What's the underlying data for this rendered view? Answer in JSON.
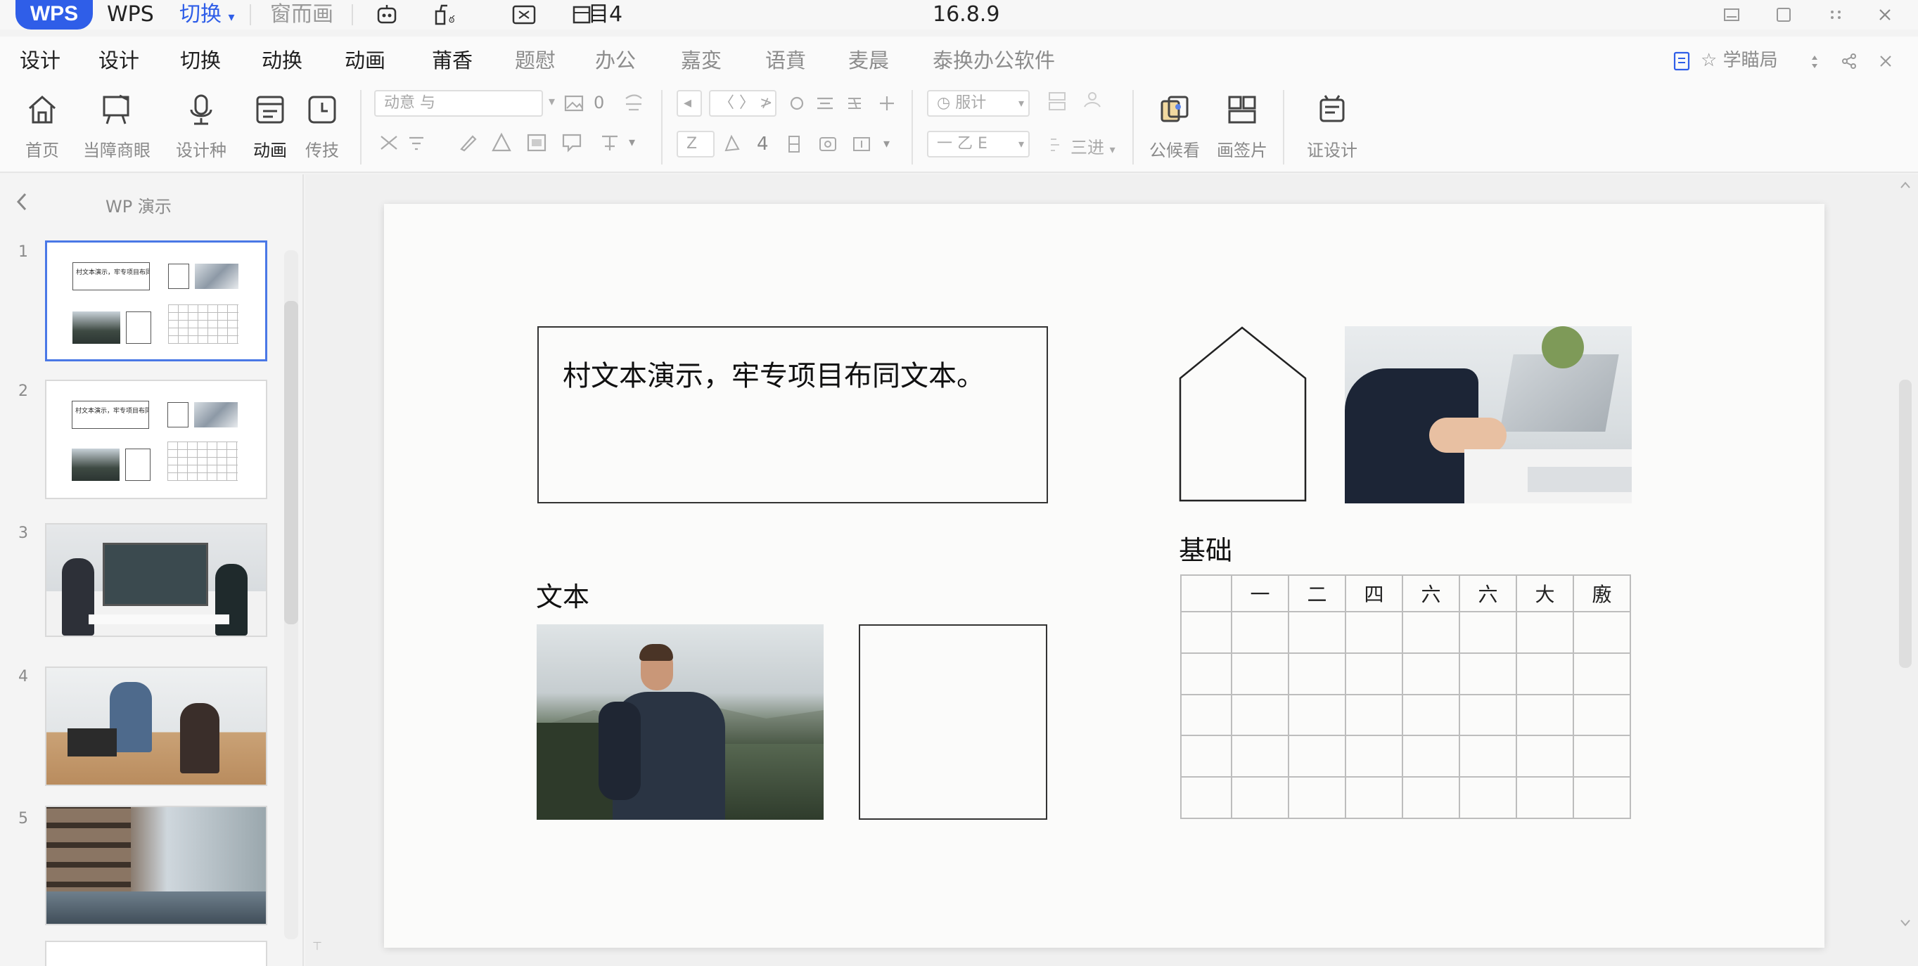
{
  "titlebar": {
    "logo": "WPS",
    "app_name": "WPS",
    "switch_menu": "切换",
    "doc_tab": "窗而画",
    "counter": "目4",
    "version": "16.8.9"
  },
  "menu": {
    "items": [
      "设计",
      "设计",
      "切换",
      "动换",
      "动画",
      "莆香",
      "题慰",
      "办公",
      "嘉変",
      "语賁",
      "麦晨",
      "泰换办公软件"
    ],
    "right_label": "☆ 学瞄局"
  },
  "ribbon": {
    "home": "首页",
    "screen_edit": "当障商眼",
    "design_kit": "设计种",
    "animation": "动画",
    "transfer": "传技",
    "font_name_placeholder": "动意 与",
    "font_size": "0",
    "style_select": "◷ 服计",
    "layout_select": "一 乙 E",
    "three_way": "三进",
    "size_value": "Z",
    "number_value": "4",
    "public_library": "公候看",
    "gallery": "画签片",
    "redesign": "证设计"
  },
  "left_panel": {
    "title": "WP 演示",
    "slides": [
      {
        "num": "1",
        "caption": "村文本演示，牢专项目布同文本"
      },
      {
        "num": "2",
        "caption": "村文本演示，牢专项目布同文本"
      },
      {
        "num": "3"
      },
      {
        "num": "4"
      },
      {
        "num": "5"
      }
    ]
  },
  "slide": {
    "text_box": "村文本演示，牢专项目布同文本。",
    "label_text": "文本",
    "label_basic": "基础",
    "table_header": [
      "",
      "一",
      "二",
      "四",
      "六",
      "六",
      "大",
      "廒"
    ]
  },
  "colors": {
    "accent": "#2f5ee8",
    "selection": "#4a78e6",
    "slide_bg": "#fbfbfa"
  }
}
